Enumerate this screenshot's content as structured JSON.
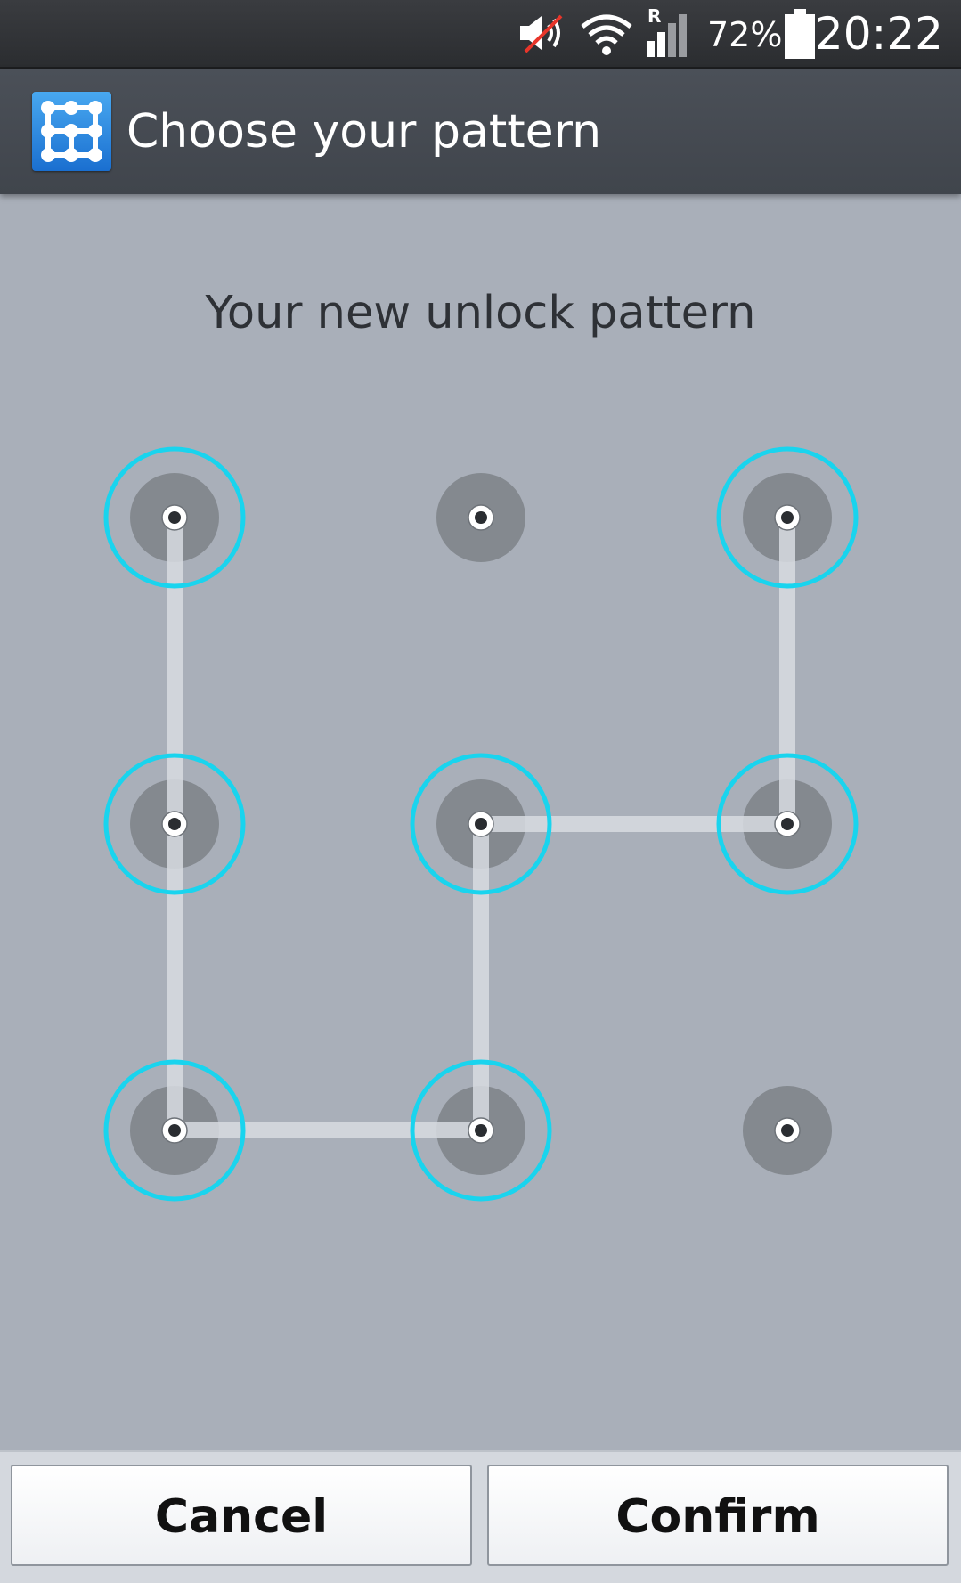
{
  "status_bar": {
    "time": "20:22",
    "battery_percent": "72%",
    "network_roaming_letter": "R",
    "icons": [
      "muted-speaker-icon",
      "wifi-icon",
      "signal-icon",
      "battery-icon"
    ]
  },
  "action_bar": {
    "title": "Choose your pattern",
    "icon": "pattern-lock-app-icon",
    "icon_color": "#2a86e0"
  },
  "prompt": "Your new unlock pattern",
  "pattern": {
    "grid_size": 3,
    "selected_dots": [
      1,
      4,
      7,
      8,
      5,
      6,
      3
    ],
    "accent_color": "#19d4ee",
    "line_color": "#d8dce2",
    "dot_color": "#84898f"
  },
  "buttons": {
    "cancel": "Cancel",
    "confirm": "Confirm"
  }
}
